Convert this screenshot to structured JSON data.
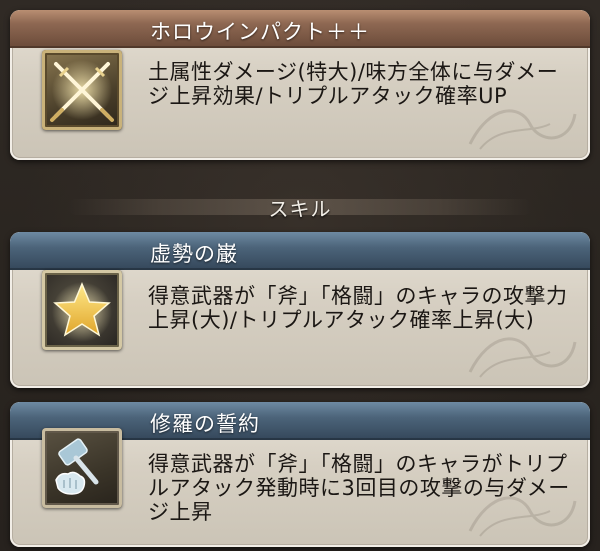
{
  "cards": [
    {
      "title": "ホロウインパクト＋＋",
      "description": "土属性ダメージ(特大)/味方全体に与ダメージ上昇効果/トリプルアタック確率UP",
      "icon": "crossed-swords-icon",
      "header_color": "#7a5542"
    },
    {
      "title": "虚勢の巌",
      "description": "得意武器が「斧」「格闘」のキャラの攻撃力上昇(大)/トリプルアタック確率上昇(大)",
      "icon": "star-icon",
      "header_color": "#3e5368"
    },
    {
      "title": "修羅の誓約",
      "description": "得意武器が「斧」「格闘」のキャラがトリプルアタック発動時に3回目の攻撃の与ダメージ上昇",
      "icon": "axe-fist-icon",
      "header_color": "#3e5368"
    }
  ],
  "section": {
    "label": "スキル"
  }
}
